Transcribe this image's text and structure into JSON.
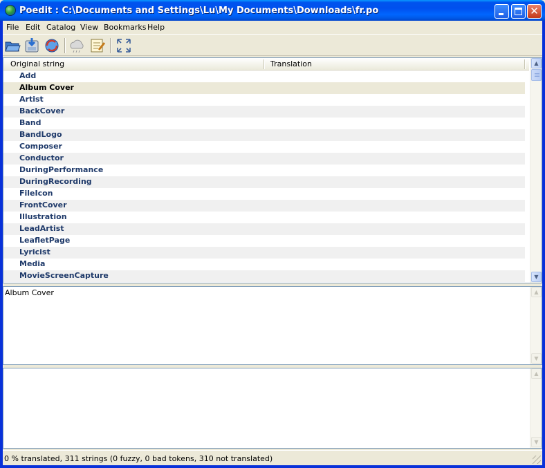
{
  "window": {
    "title": "Poedit : C:\\Documents and Settings\\Lu\\My Documents\\Downloads\\fr.po",
    "close_glyph": "✕"
  },
  "menu": {
    "items": [
      "File",
      "Edit",
      "Catalog",
      "View",
      "Bookmarks",
      "Help"
    ]
  },
  "toolbar": {
    "icons": [
      "open-folder-icon",
      "save-icon",
      "update-catalog-icon",
      "validate-translations-icon",
      "edit-comment-icon",
      "fullscreen-icon"
    ]
  },
  "list": {
    "headers": [
      "Original string",
      "Translation"
    ],
    "selected_index": 1,
    "rows": [
      "Add",
      "Album Cover",
      "Artist",
      "BackCover",
      "Band",
      "BandLogo",
      "Composer",
      "Conductor",
      "DuringPerformance",
      "DuringRecording",
      "FileIcon",
      "FrontCover",
      "Illustration",
      "LeadArtist",
      "LeafletPage",
      "Lyricist",
      "Media",
      "MovieScreenCapture"
    ]
  },
  "editor": {
    "original_text": "Album Cover",
    "translation_text": ""
  },
  "status": {
    "text": "0 % translated, 311 strings (0 fuzzy, 0 bad tokens, 310 not translated)"
  },
  "colors": {
    "titlebar": "#0055e5",
    "row_text": "#1f3a6a",
    "selected_row": "#ece9d8",
    "alt_row": "#f0f0f0"
  }
}
